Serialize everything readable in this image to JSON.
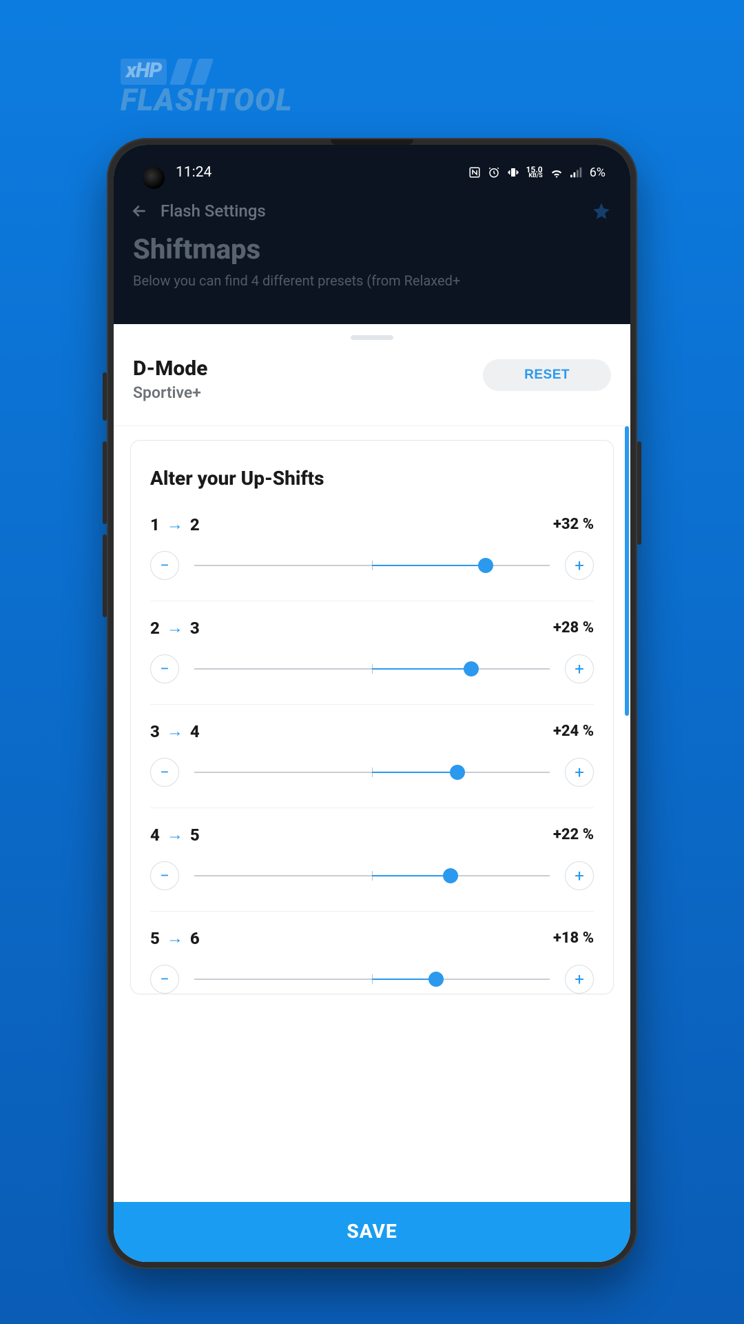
{
  "logo": {
    "badge": "xHP",
    "text": "FLASHTOOL"
  },
  "status": {
    "time": "11:24",
    "speed_value": "15.0",
    "speed_unit": "KB/S",
    "battery": "6%"
  },
  "nav": {
    "title": "Flash Settings"
  },
  "page": {
    "title": "Shiftmaps",
    "description": "Below you can find 4 different presets (from Relaxed+"
  },
  "sheet": {
    "mode_title": "D-Mode",
    "mode_subtitle": "Sportive+",
    "reset_label": "RESET",
    "section_title": "Alter your Up-Shifts"
  },
  "shifts": [
    {
      "from": "1",
      "to": "2",
      "pct_label": "+32 %",
      "value": 32,
      "min": -50,
      "max": 50
    },
    {
      "from": "2",
      "to": "3",
      "pct_label": "+28 %",
      "value": 28,
      "min": -50,
      "max": 50
    },
    {
      "from": "3",
      "to": "4",
      "pct_label": "+24 %",
      "value": 24,
      "min": -50,
      "max": 50
    },
    {
      "from": "4",
      "to": "5",
      "pct_label": "+22 %",
      "value": 22,
      "min": -50,
      "max": 50
    },
    {
      "from": "5",
      "to": "6",
      "pct_label": "+18 %",
      "value": 18,
      "min": -50,
      "max": 50
    }
  ],
  "save_label": "SAVE",
  "colors": {
    "accent": "#2a99ee",
    "save_bg": "#1a9cf2"
  }
}
